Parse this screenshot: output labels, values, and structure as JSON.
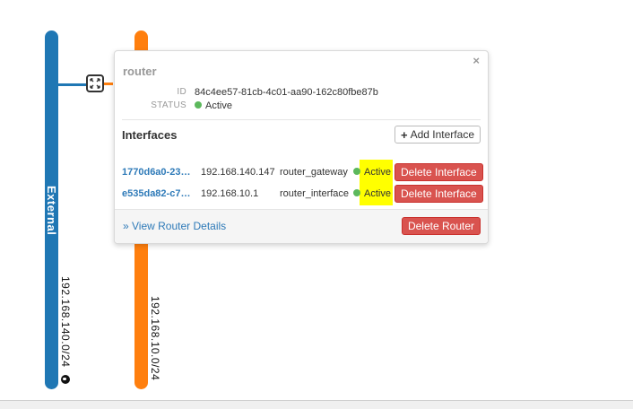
{
  "networks": {
    "external": {
      "name": "External",
      "cidr": "192.168.140.0/24",
      "color": "#1f77b4"
    },
    "internal": {
      "cidr": "192.168.10.0/24",
      "color": "#ff7f0e"
    }
  },
  "router_popup": {
    "title": "router",
    "close_glyph": "×",
    "id_label": "ID",
    "id_value": "84c4ee57-81cb-4c01-aa90-162c80fbe87b",
    "status_label": "STATUS",
    "status_value": "Active",
    "interfaces_title": "Interfaces",
    "add_interface_label": "Add Interface",
    "interfaces": [
      {
        "id": "1770d6a0-23…",
        "ip": "192.168.140.147",
        "type": "router_gateway",
        "status": "Active",
        "delete_label": "Delete Interface"
      },
      {
        "id": "e535da82-c7…",
        "ip": "192.168.10.1",
        "type": "router_interface",
        "status": "Active",
        "delete_label": "Delete Interface"
      }
    ],
    "view_details_label": "» View Router Details",
    "delete_router_label": "Delete Router"
  },
  "colors": {
    "active": "#5cb85c",
    "danger": "#d9534f",
    "link": "#2e7ab8",
    "highlight": "#ffff00"
  },
  "icons": {
    "router": "router-icon",
    "globe": "globe-icon",
    "plus": "plus-icon",
    "close": "close-icon"
  }
}
